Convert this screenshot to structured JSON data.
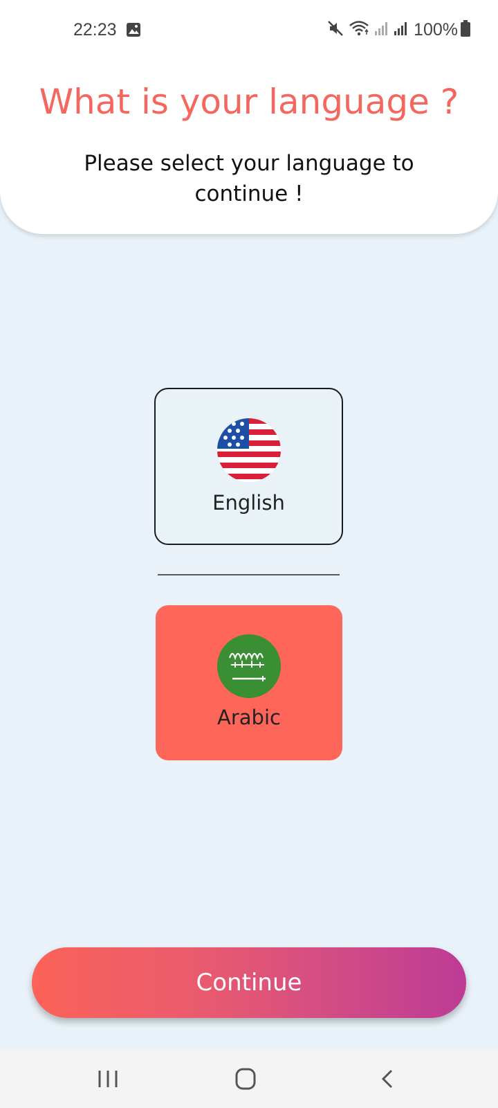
{
  "status_bar": {
    "time": "22:23",
    "battery_text": "100%",
    "icons": [
      "gallery-icon",
      "mute-icon",
      "wifi-icon",
      "signal-icon",
      "signal-icon",
      "battery-icon"
    ]
  },
  "header": {
    "title": "What is your language ?",
    "subtitle": "Please select your language to continue !"
  },
  "languages": [
    {
      "label": "English",
      "flag": "us-flag-icon",
      "selected": false
    },
    {
      "label": "Arabic",
      "flag": "saudi-flag-icon",
      "selected": true
    }
  ],
  "continue_button": {
    "label": "Continue"
  },
  "nav_bar": {
    "icons": [
      "recents-icon",
      "home-icon",
      "back-icon"
    ]
  },
  "colors": {
    "accent": "#f4675e",
    "selected_card": "#fe665a",
    "background": "#e8f2f8",
    "gradient_start": "#fb6358",
    "gradient_end": "#bd3b95"
  }
}
